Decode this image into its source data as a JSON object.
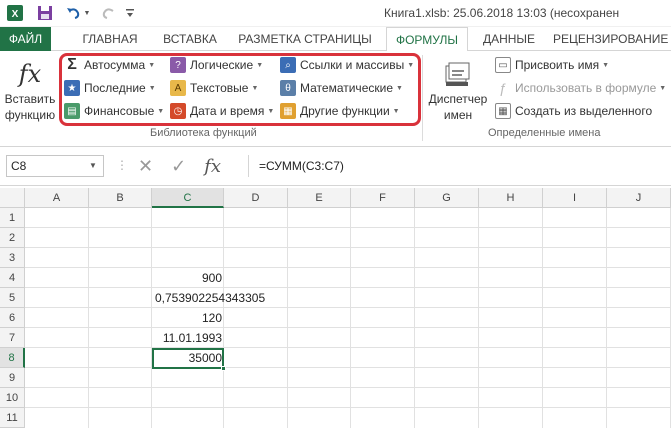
{
  "titlebar": {
    "document_title": "Книга1.xlsb: 25.06.2018 13:03 (несохранен",
    "quick_access": [
      "excel-logo-icon",
      "save-icon",
      "undo-icon",
      "undo-dropdown-icon",
      "customize-qat-icon"
    ]
  },
  "tabs": [
    {
      "label": "ФАЙЛ"
    },
    {
      "label": "ГЛАВНАЯ"
    },
    {
      "label": "ВСТАВКА"
    },
    {
      "label": "РАЗМЕТКА СТРАНИЦЫ"
    },
    {
      "label": "ФОРМУЛЫ"
    },
    {
      "label": "ДАННЫЕ"
    },
    {
      "label": "РЕЦЕНЗИРОВАНИЕ"
    }
  ],
  "ribbon": {
    "insert_function": {
      "line1": "Вставить",
      "line2": "функцию",
      "icon": "fx-icon"
    },
    "library": {
      "label": "Библиотека функций",
      "items": [
        {
          "label": "Автосумма",
          "icon": "autosum-icon"
        },
        {
          "label": "Последние",
          "icon": "recent-star-icon"
        },
        {
          "label": "Финансовые",
          "icon": "financial-icon"
        },
        {
          "label": "Логические",
          "icon": "logical-icon"
        },
        {
          "label": "Текстовые",
          "icon": "text-icon"
        },
        {
          "label": "Дата и время",
          "icon": "datetime-icon"
        },
        {
          "label": "Ссылки и массивы",
          "icon": "lookup-icon"
        },
        {
          "label": "Математические",
          "icon": "math-icon"
        },
        {
          "label": "Другие функции",
          "icon": "more-functions-icon"
        }
      ]
    },
    "names": {
      "label": "Определенные имена",
      "manager": {
        "line1": "Диспетчер",
        "line2": "имен",
        "icon": "name-manager-icon"
      },
      "items": [
        {
          "label": "Присвоить имя"
        },
        {
          "label": "Использовать в формуле"
        },
        {
          "label": "Создать из выделенного"
        }
      ]
    },
    "accent_color": "#217346",
    "highlight_color": "#d9323b"
  },
  "formula_bar": {
    "name_box": "C8",
    "formula": "=СУММ(C3:C7)",
    "cancel_glyph": "✕",
    "enter_glyph": "✓",
    "fx_glyph": "fx"
  },
  "sheet": {
    "columns": [
      "A",
      "B",
      "C",
      "D",
      "E",
      "F",
      "G",
      "H",
      "I",
      "J"
    ],
    "rows": [
      "1",
      "2",
      "3",
      "4",
      "5",
      "6",
      "7",
      "8",
      "9",
      "10",
      "11"
    ],
    "selected_column": "C",
    "selected_row": "8",
    "cells": {
      "C4": "900",
      "C5": "0,753902254343305",
      "C6": "120",
      "C7": "11.01.1993",
      "C8": "35000"
    }
  }
}
